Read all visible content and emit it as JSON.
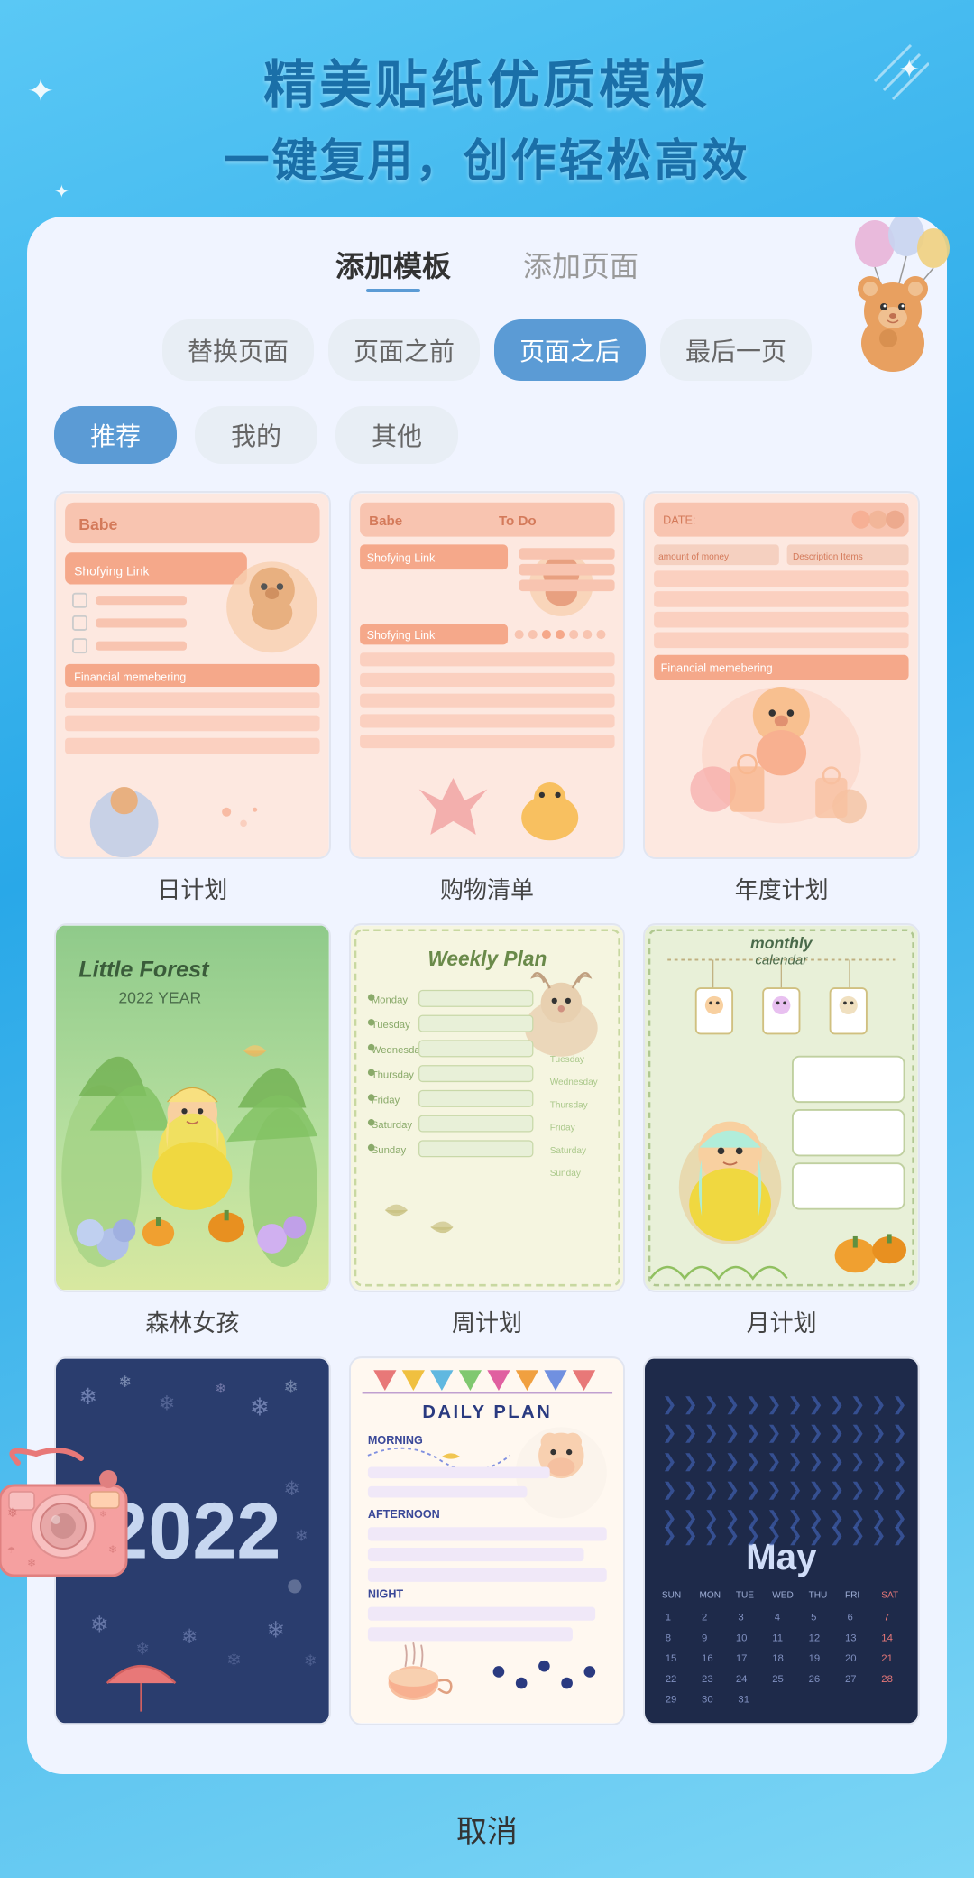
{
  "header": {
    "title_line1": "精美贴纸优质模板",
    "title_line2": "一键复用，创作轻松高效"
  },
  "tabs": [
    {
      "id": "add-template",
      "label": "添加模板",
      "active": true
    },
    {
      "id": "add-page",
      "label": "添加页面",
      "active": false
    }
  ],
  "position_buttons": [
    {
      "id": "replace",
      "label": "替换页面",
      "active": false
    },
    {
      "id": "before",
      "label": "页面之前",
      "active": false
    },
    {
      "id": "after",
      "label": "页面之后",
      "active": true
    },
    {
      "id": "last",
      "label": "最后一页",
      "active": false
    }
  ],
  "category_buttons": [
    {
      "id": "recommend",
      "label": "推荐",
      "active": true
    },
    {
      "id": "mine",
      "label": "我的",
      "active": false
    },
    {
      "id": "other",
      "label": "其他",
      "active": false
    }
  ],
  "templates": [
    {
      "id": "daily",
      "label": "日计划",
      "type": "daily"
    },
    {
      "id": "shopping",
      "label": "购物清单",
      "type": "shopping"
    },
    {
      "id": "yearly",
      "label": "年度计划",
      "type": "yearly"
    },
    {
      "id": "forest",
      "label": "森林女孩",
      "type": "forest"
    },
    {
      "id": "weekly",
      "label": "周计划",
      "type": "weekly"
    },
    {
      "id": "monthly",
      "label": "月计划",
      "type": "monthly"
    },
    {
      "id": "y2022",
      "label": "",
      "type": "2022"
    },
    {
      "id": "dailyplan",
      "label": "",
      "type": "dailyplan"
    },
    {
      "id": "maycalendar",
      "label": "",
      "type": "maycalendar"
    }
  ],
  "cancel": {
    "label": "取消"
  },
  "weekly_plan_text": "Weekly  Plan"
}
